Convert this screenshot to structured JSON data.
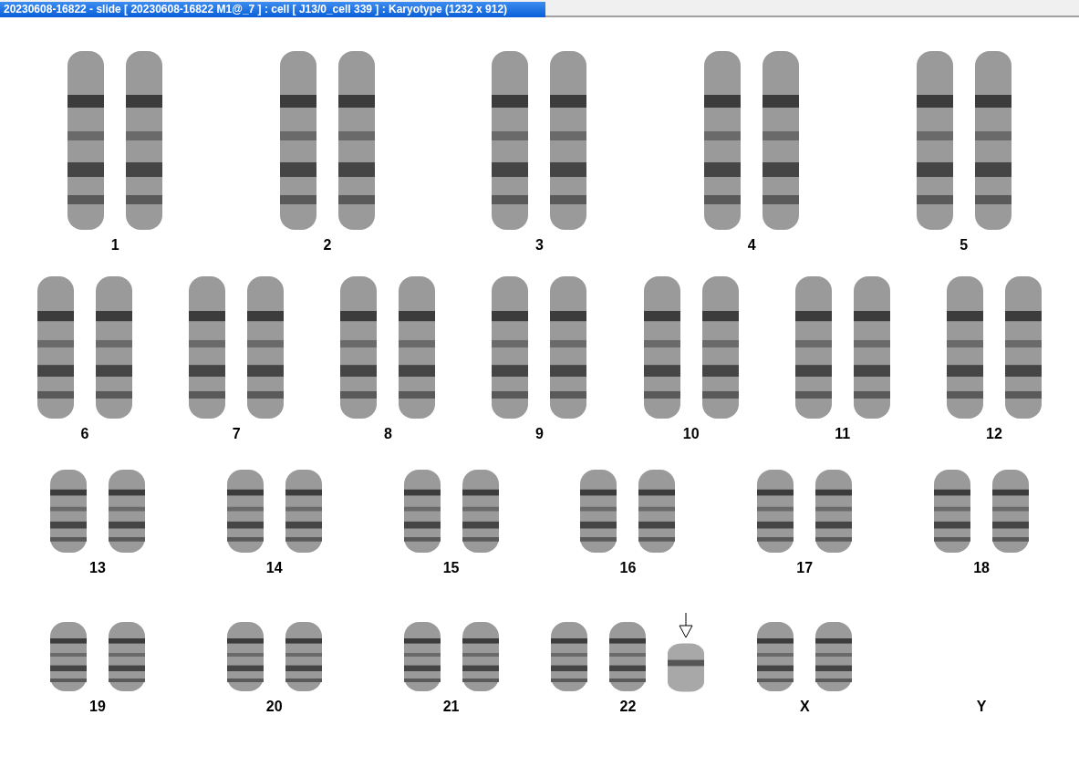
{
  "window": {
    "title": "20230608-16822 - slide [ 20230608-16822 M1@_7 ] : cell [ J13/0_cell 339 ] : Karyotype  (1232 x 912)"
  },
  "karyotype": {
    "rows": [
      {
        "groups": [
          {
            "label": "1",
            "chromosomes": [
              {
                "kind": "normal"
              },
              {
                "kind": "normal"
              }
            ]
          },
          {
            "label": "2",
            "chromosomes": [
              {
                "kind": "normal"
              },
              {
                "kind": "normal"
              }
            ]
          },
          {
            "label": "3",
            "chromosomes": [
              {
                "kind": "normal"
              },
              {
                "kind": "normal"
              }
            ]
          },
          {
            "label": "4",
            "chromosomes": [
              {
                "kind": "normal"
              },
              {
                "kind": "normal"
              }
            ]
          },
          {
            "label": "5",
            "chromosomes": [
              {
                "kind": "normal"
              },
              {
                "kind": "normal"
              }
            ]
          }
        ]
      },
      {
        "groups": [
          {
            "label": "6",
            "chromosomes": [
              {
                "kind": "normal"
              },
              {
                "kind": "normal"
              }
            ]
          },
          {
            "label": "7",
            "chromosomes": [
              {
                "kind": "normal"
              },
              {
                "kind": "normal"
              }
            ]
          },
          {
            "label": "8",
            "chromosomes": [
              {
                "kind": "normal"
              },
              {
                "kind": "normal"
              }
            ]
          },
          {
            "label": "9",
            "chromosomes": [
              {
                "kind": "normal"
              },
              {
                "kind": "normal"
              }
            ]
          },
          {
            "label": "10",
            "chromosomes": [
              {
                "kind": "normal"
              },
              {
                "kind": "normal"
              }
            ]
          },
          {
            "label": "11",
            "chromosomes": [
              {
                "kind": "normal"
              },
              {
                "kind": "normal"
              }
            ]
          },
          {
            "label": "12",
            "chromosomes": [
              {
                "kind": "normal"
              },
              {
                "kind": "normal"
              }
            ]
          }
        ]
      },
      {
        "groups": [
          {
            "label": "13",
            "chromosomes": [
              {
                "kind": "normal"
              },
              {
                "kind": "normal"
              }
            ]
          },
          {
            "label": "14",
            "chromosomes": [
              {
                "kind": "normal"
              },
              {
                "kind": "normal"
              }
            ]
          },
          {
            "label": "15",
            "chromosomes": [
              {
                "kind": "normal"
              },
              {
                "kind": "normal"
              }
            ]
          },
          {
            "label": "16",
            "chromosomes": [
              {
                "kind": "normal"
              },
              {
                "kind": "normal"
              }
            ]
          },
          {
            "label": "17",
            "chromosomes": [
              {
                "kind": "normal"
              },
              {
                "kind": "normal"
              }
            ]
          },
          {
            "label": "18",
            "chromosomes": [
              {
                "kind": "normal"
              },
              {
                "kind": "normal"
              }
            ]
          }
        ]
      },
      {
        "groups": [
          {
            "label": "19",
            "chromosomes": [
              {
                "kind": "normal"
              },
              {
                "kind": "normal"
              }
            ]
          },
          {
            "label": "20",
            "chromosomes": [
              {
                "kind": "normal"
              },
              {
                "kind": "normal"
              }
            ]
          },
          {
            "label": "21",
            "chromosomes": [
              {
                "kind": "normal"
              },
              {
                "kind": "normal"
              }
            ]
          },
          {
            "label": "22",
            "chromosomes": [
              {
                "kind": "normal"
              },
              {
                "kind": "normal"
              },
              {
                "kind": "marked"
              }
            ]
          },
          {
            "label": "X",
            "chromosomes": [
              {
                "kind": "normal"
              },
              {
                "kind": "normal"
              }
            ]
          },
          {
            "label": "Y"
          }
        ]
      }
    ]
  }
}
